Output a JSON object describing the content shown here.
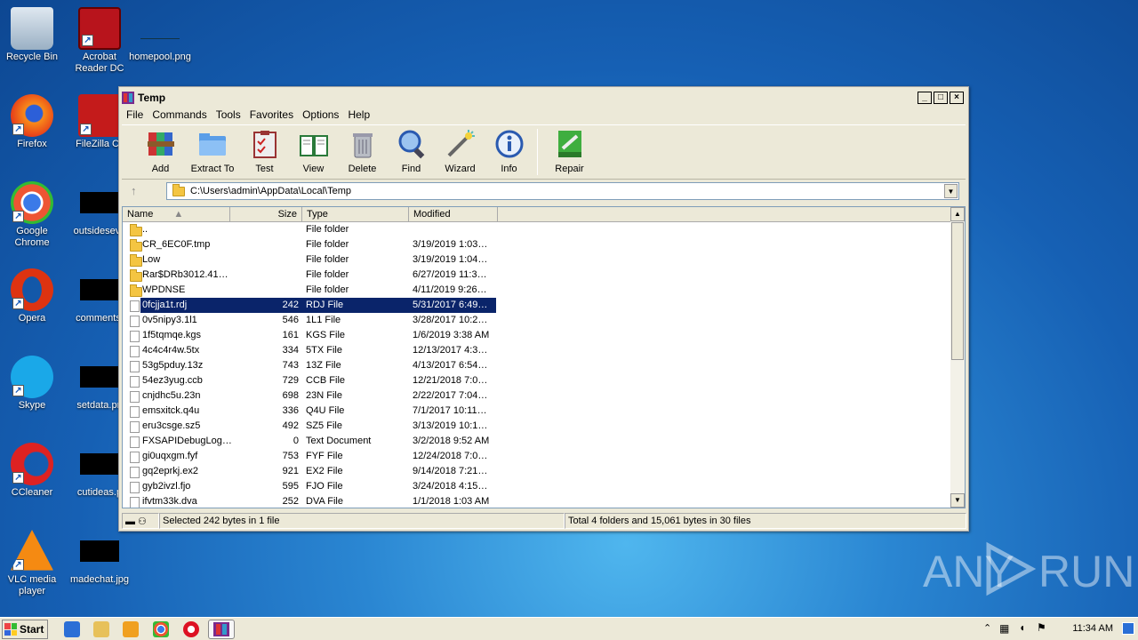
{
  "desktop": {
    "icons": [
      {
        "label": "Recycle Bin",
        "icon": "recycle-bin-icon"
      },
      {
        "label": "Acrobat Reader DC",
        "icon": "acrobat-icon"
      },
      {
        "label": "homepool.png",
        "icon": "image-file-icon"
      },
      {
        "label": "Firefox",
        "icon": "firefox-icon"
      },
      {
        "label": "FileZilla Cli",
        "icon": "filezilla-icon"
      },
      {
        "label": "Google Chrome",
        "icon": "chrome-icon"
      },
      {
        "label": "outsideseve",
        "icon": "image-file-icon"
      },
      {
        "label": "Opera",
        "icon": "opera-icon"
      },
      {
        "label": "comments.",
        "icon": "image-file-icon"
      },
      {
        "label": "Skype",
        "icon": "skype-icon"
      },
      {
        "label": "setdata.pn",
        "icon": "image-file-icon"
      },
      {
        "label": "CCleaner",
        "icon": "ccleaner-icon"
      },
      {
        "label": "cutideas.p",
        "icon": "image-file-icon"
      },
      {
        "label": "VLC media player",
        "icon": "vlc-icon"
      },
      {
        "label": "madechat.jpg",
        "icon": "image-file-icon"
      }
    ],
    "watermark": "ANY RUN"
  },
  "window": {
    "title": "Temp",
    "menu": [
      "File",
      "Commands",
      "Tools",
      "Favorites",
      "Options",
      "Help"
    ],
    "toolbar": [
      "Add",
      "Extract To",
      "Test",
      "View",
      "Delete",
      "Find",
      "Wizard",
      "Info",
      "Repair"
    ],
    "address": "C:\\Users\\admin\\AppData\\Local\\Temp",
    "columns": {
      "name": "Name",
      "size": "Size",
      "type": "Type",
      "modified": "Modified"
    },
    "rows": [
      {
        "name": "..",
        "size": "",
        "type": "File folder",
        "modified": "",
        "kind": "folder"
      },
      {
        "name": "CR_6EC0F.tmp",
        "size": "",
        "type": "File folder",
        "modified": "3/19/2019 1:03…",
        "kind": "folder"
      },
      {
        "name": "Low",
        "size": "",
        "type": "File folder",
        "modified": "3/19/2019 1:04…",
        "kind": "folder"
      },
      {
        "name": "Rar$DRb3012.41…",
        "size": "",
        "type": "File folder",
        "modified": "6/27/2019 11:3…",
        "kind": "folder"
      },
      {
        "name": "WPDNSE",
        "size": "",
        "type": "File folder",
        "modified": "4/11/2019 9:26…",
        "kind": "folder"
      },
      {
        "name": "0fcjja1t.rdj",
        "size": "242",
        "type": "RDJ File",
        "modified": "5/31/2017 6:49…",
        "kind": "file",
        "selected": true
      },
      {
        "name": "0v5nipy3.1l1",
        "size": "546",
        "type": "1L1 File",
        "modified": "3/28/2017 10:2…",
        "kind": "file"
      },
      {
        "name": "1f5tqmqe.kgs",
        "size": "161",
        "type": "KGS File",
        "modified": "1/6/2019 3:38 AM",
        "kind": "file"
      },
      {
        "name": "4c4c4r4w.5tx",
        "size": "334",
        "type": "5TX File",
        "modified": "12/13/2017 4:3…",
        "kind": "file"
      },
      {
        "name": "53g5pduy.13z",
        "size": "743",
        "type": "13Z File",
        "modified": "4/13/2017 6:54…",
        "kind": "file"
      },
      {
        "name": "54ez3yug.ccb",
        "size": "729",
        "type": "CCB File",
        "modified": "12/21/2018 7:0…",
        "kind": "file"
      },
      {
        "name": "cnjdhc5u.23n",
        "size": "698",
        "type": "23N File",
        "modified": "2/22/2017 7:04…",
        "kind": "file"
      },
      {
        "name": "emsxitck.q4u",
        "size": "336",
        "type": "Q4U File",
        "modified": "7/1/2017 10:11…",
        "kind": "file"
      },
      {
        "name": "eru3csge.sz5",
        "size": "492",
        "type": "SZ5 File",
        "modified": "3/13/2019 10:1…",
        "kind": "file"
      },
      {
        "name": "FXSAPIDebugLog…",
        "size": "0",
        "type": "Text Document",
        "modified": "3/2/2018 9:52 AM",
        "kind": "file"
      },
      {
        "name": "gi0uqxgm.fyf",
        "size": "753",
        "type": "FYF File",
        "modified": "12/24/2018 7:0…",
        "kind": "file"
      },
      {
        "name": "gq2eprkj.ex2",
        "size": "921",
        "type": "EX2 File",
        "modified": "9/14/2018 7:21…",
        "kind": "file"
      },
      {
        "name": "gyb2ivzl.fjo",
        "size": "595",
        "type": "FJO File",
        "modified": "3/24/2018 4:15…",
        "kind": "file"
      },
      {
        "name": "ifvtm33k.dva",
        "size": "252",
        "type": "DVA File",
        "modified": "1/1/2018 1:03 AM",
        "kind": "file"
      }
    ],
    "status_left": "Selected 242 bytes in 1 file",
    "status_right": "Total 4 folders and 15,061 bytes in 30 files"
  },
  "taskbar": {
    "start": "Start",
    "clock": "11:34 AM"
  }
}
